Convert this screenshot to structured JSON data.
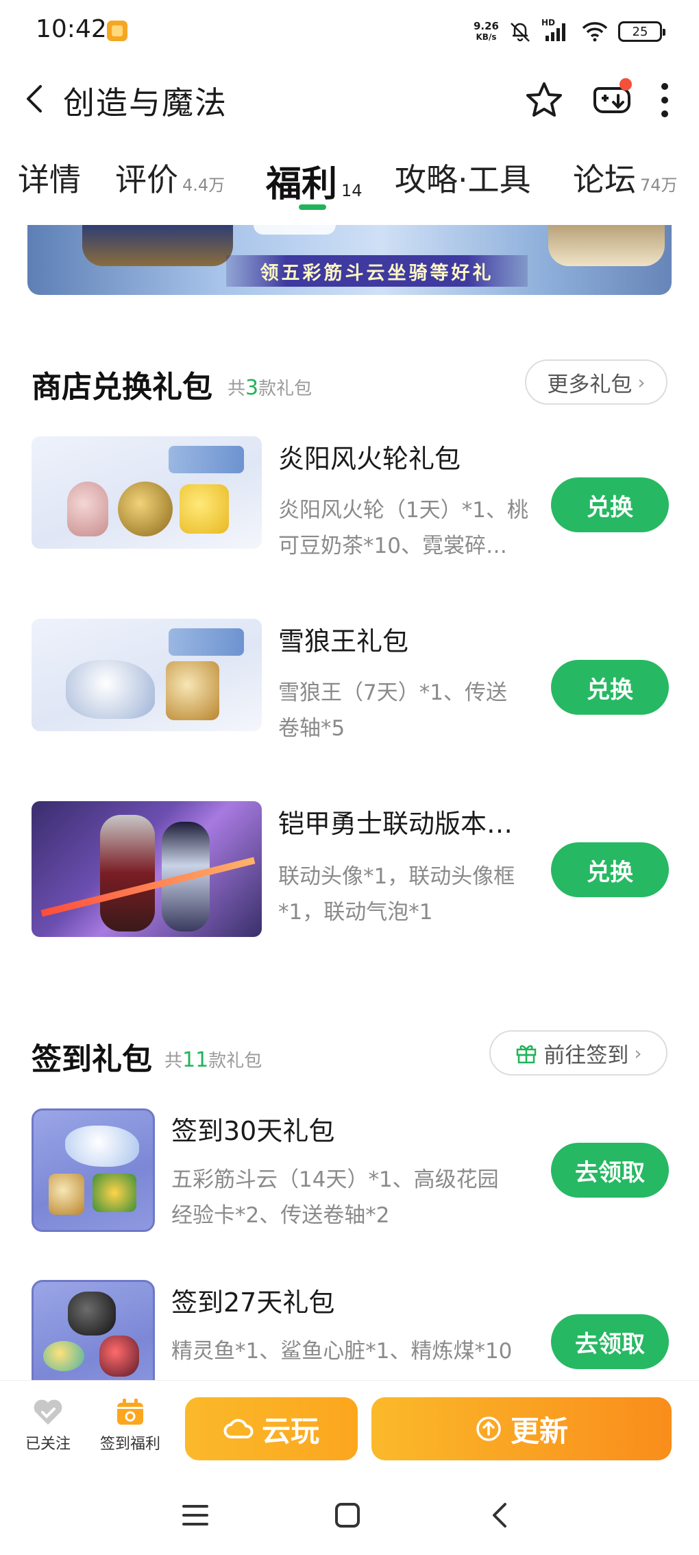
{
  "status_bar": {
    "time": "10:42",
    "net_speed_value": "9.26",
    "net_speed_unit": "KB/s",
    "signal_label": "HD",
    "battery": "25"
  },
  "header": {
    "title": "创造与魔法"
  },
  "tabs": [
    {
      "label": "详情",
      "count": ""
    },
    {
      "label": "评价",
      "count": "4.4万"
    },
    {
      "label": "福利",
      "count": "14"
    },
    {
      "label": "攻略·工具",
      "count": ""
    },
    {
      "label": "论坛",
      "count": "74万"
    }
  ],
  "active_tab": "福利",
  "banner": {
    "text": "领五彩筋斗云坐骑等好礼"
  },
  "shop_section": {
    "title": "商店兑换礼包",
    "sub_prefix": "共",
    "sub_count": "3",
    "sub_suffix": "款礼包",
    "more_label": "更多礼包",
    "items": [
      {
        "name": "炎阳风火轮礼包",
        "desc_line1": "炎阳风火轮（1天）*1、桃",
        "desc_line2": "可豆奶茶*10、霓裳碎…",
        "button": "兑换"
      },
      {
        "name": "雪狼王礼包",
        "desc_line1": "雪狼王（7天）*1、传送",
        "desc_line2": "卷轴*5",
        "button": "兑换"
      },
      {
        "name": "铠甲勇士联动版本…",
        "desc_line1": "联动头像*1，联动头像框",
        "desc_line2": "*1，联动气泡*1",
        "button": "兑换"
      }
    ]
  },
  "checkin_section": {
    "title": "签到礼包",
    "sub_prefix": "共",
    "sub_count": "11",
    "sub_suffix": "款礼包",
    "goto_label": "前往签到",
    "items": [
      {
        "name": "签到30天礼包",
        "desc_line1": "五彩筋斗云（14天）*1、高级花园",
        "desc_line2": "经验卡*2、传送卷轴*2",
        "button": "去领取"
      },
      {
        "name": "签到27天礼包",
        "desc_line1": "精灵鱼*1、鲨鱼心脏*1、精炼煤*10",
        "desc_line2": "",
        "button": "去领取"
      }
    ]
  },
  "bottom_bar": {
    "follow_label": "已关注",
    "checkin_label": "签到福利",
    "cloud_label": "云玩",
    "update_label": "更新"
  },
  "colors": {
    "accent_green": "#27b863",
    "accent_orange": "#fca61e"
  }
}
